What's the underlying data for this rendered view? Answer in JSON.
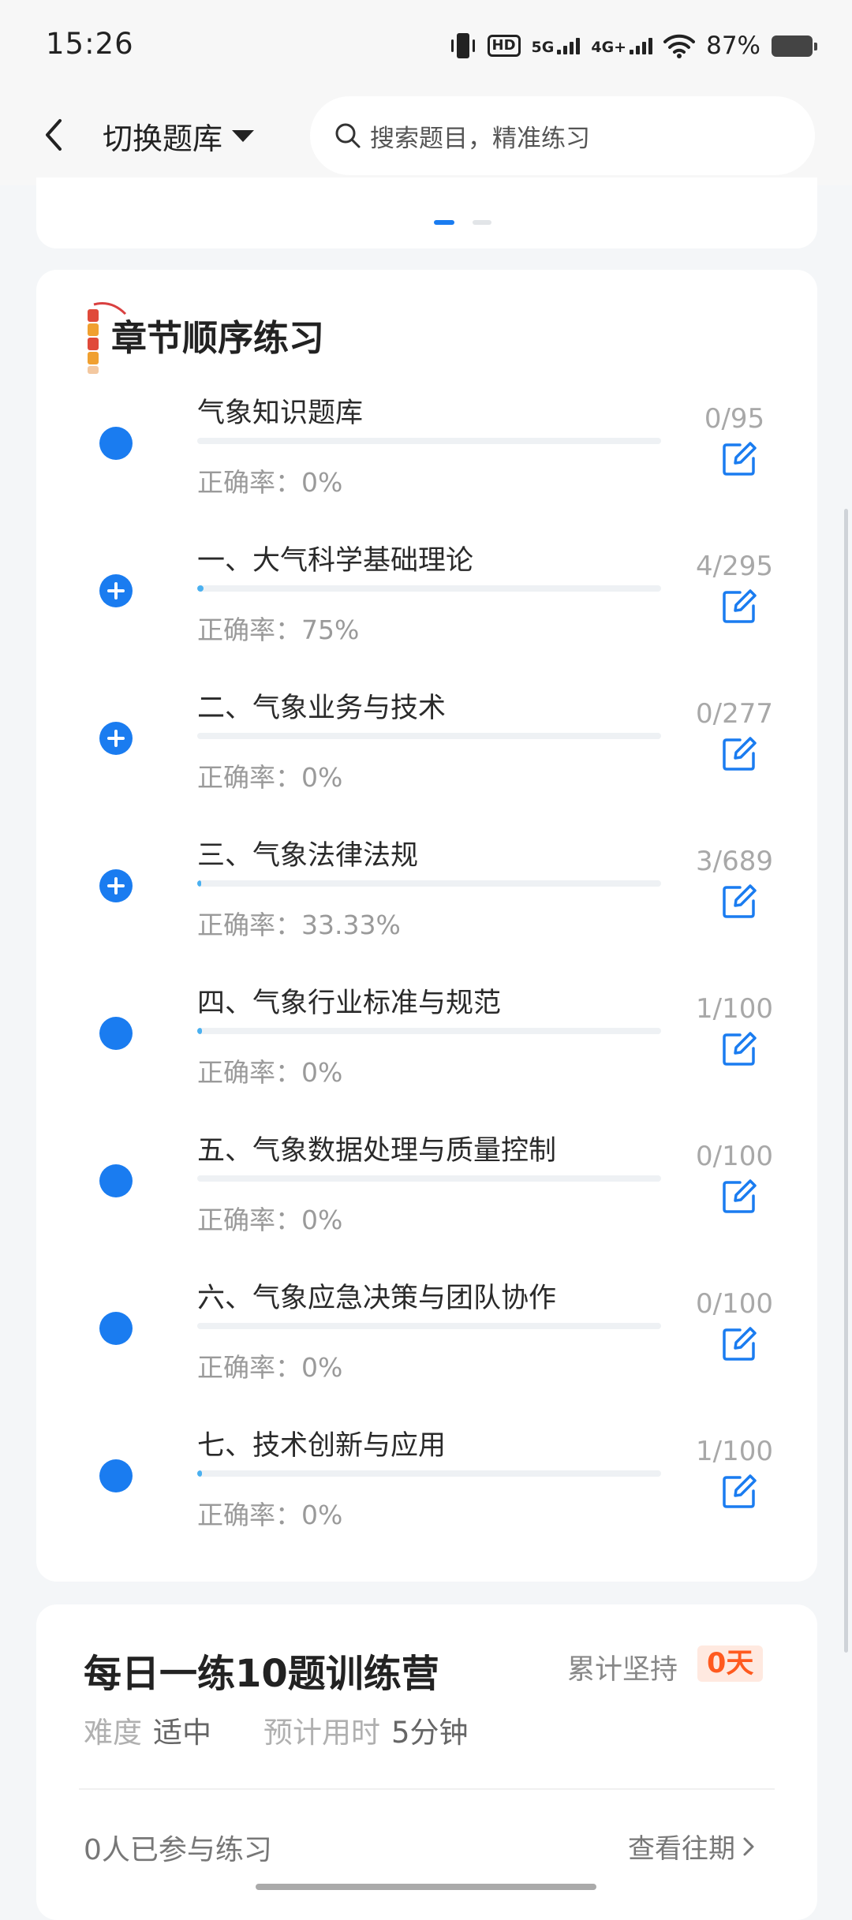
{
  "status_bar": {
    "time": "15:26",
    "hd_badge": "HD",
    "net_5g": "5G",
    "net_4g": "4G+",
    "battery": "87%"
  },
  "header": {
    "bank_switch_label": "切换题库",
    "search_placeholder": "搜索题目，精准练习"
  },
  "carousel": {
    "pages": 2,
    "active_page": 1
  },
  "chapters": {
    "title": "章节顺序练习",
    "accuracy_prefix": "正确率：",
    "items": [
      {
        "title": "气象知识题库",
        "count": "0/95",
        "accuracy": "0%",
        "expandable": false,
        "progress": 0
      },
      {
        "title": "一、大气科学基础理论",
        "count": "4/295",
        "accuracy": "75%",
        "expandable": true,
        "progress": 0.0136
      },
      {
        "title": "二、气象业务与技术",
        "count": "0/277",
        "accuracy": "0%",
        "expandable": true,
        "progress": 0
      },
      {
        "title": "三、气象法律法规",
        "count": "3/689",
        "accuracy": "33.33%",
        "expandable": true,
        "progress": 0.0044
      },
      {
        "title": "四、气象行业标准与规范",
        "count": "1/100",
        "accuracy": "0%",
        "expandable": false,
        "progress": 0.01
      },
      {
        "title": "五、气象数据处理与质量控制",
        "count": "0/100",
        "accuracy": "0%",
        "expandable": false,
        "progress": 0
      },
      {
        "title": "六、气象应急决策与团队协作",
        "count": "0/100",
        "accuracy": "0%",
        "expandable": false,
        "progress": 0
      },
      {
        "title": "七、技术创新与应用",
        "count": "1/100",
        "accuracy": "0%",
        "expandable": false,
        "progress": 0.01
      }
    ]
  },
  "daily": {
    "title": "每日一练10题训练营",
    "streak_label": "累计坚持",
    "streak_value": "0天",
    "difficulty_label": "难度",
    "difficulty_value": "适中",
    "time_label": "预计用时",
    "time_value": "5分钟",
    "participants": "0人已参与练习",
    "history_link": "查看往期"
  },
  "colors": {
    "accent": "#1a7cf0",
    "progress": "#4ab0f0",
    "streak": "#ff5a1f"
  }
}
